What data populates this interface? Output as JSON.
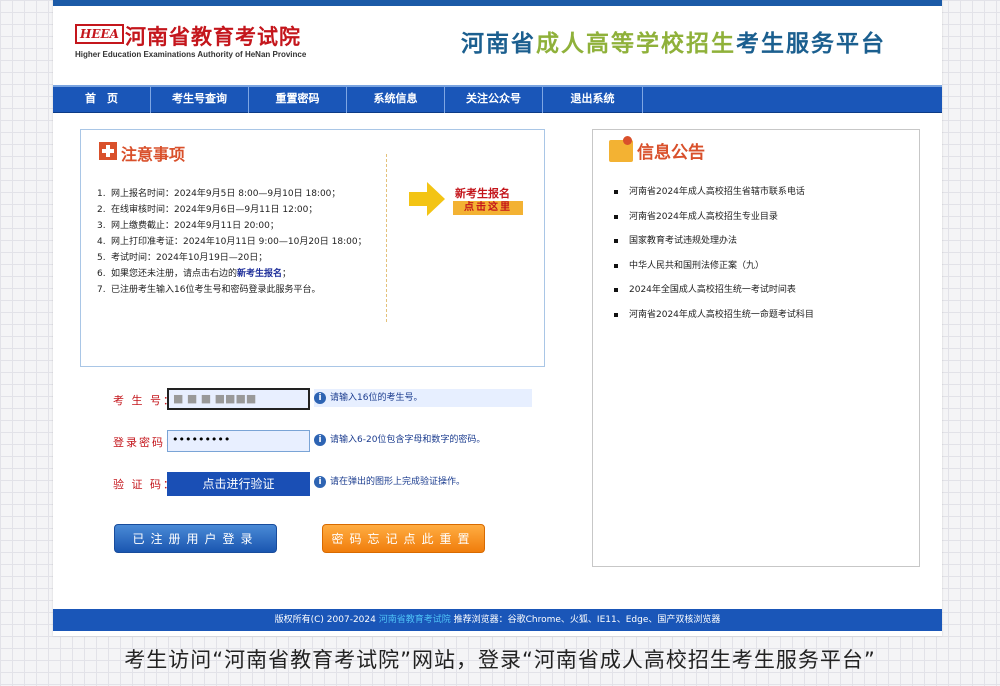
{
  "header": {
    "logo_mark": "HEEA",
    "logo_cn": "河南省教育考试院",
    "logo_en": "Higher Education Examinations Authority of HeNan Province",
    "title_part1": "河南省",
    "title_part2": "成人高等学校招生",
    "title_part3": "考生服务平台"
  },
  "nav": {
    "items": [
      "首　页",
      "考生号查询",
      "重置密码",
      "系统信息",
      "关注公众号",
      "退出系统"
    ]
  },
  "notice": {
    "title": "注意事项",
    "items": [
      {
        "num": "1.",
        "text": "网上报名时间：2024年9月5日 8:00—9月10日 18:00；"
      },
      {
        "num": "2.",
        "text": "在线审核时间：2024年9月6日—9月11日 12:00；"
      },
      {
        "num": "3.",
        "text": "网上缴费截止：2024年9月11日 20:00；"
      },
      {
        "num": "4.",
        "text": "网上打印准考证：2024年10月11日 9:00—10月20日 18:00；"
      },
      {
        "num": "5.",
        "text": "考试时间：2024年10月19日—20日；"
      },
      {
        "num": "6.",
        "text": "如果您还未注册，请点击右边的",
        "highlight": "新考生报名",
        "after": "；"
      },
      {
        "num": "7.",
        "text": "已注册考生输入16位考生号和密码登录此服务平台。"
      }
    ],
    "register_text": "新考生报名",
    "register_click": "点击这里"
  },
  "form": {
    "exam_label": "考 生 号：",
    "exam_value": "■ ■ ■ ■■■■",
    "exam_hint": "请输入16位的考生号。",
    "pwd_label": "登录密码：",
    "pwd_value": "•••••••••",
    "pwd_hint": "请输入6-20位包含字母和数字的密码。",
    "captcha_label": "验 证 码：",
    "captcha_button": "点击进行验证",
    "captcha_hint": "请在弹出的图形上完成验证操作。",
    "login_button": "已注册用户登录",
    "reset_button": "密码忘记点此重置"
  },
  "info": {
    "title": "信息公告",
    "items": [
      "河南省2024年成人高校招生省辖市联系电话",
      "河南省2024年成人高校招生专业目录",
      "国家教育考试违规处理办法",
      "中华人民共和国刑法修正案（九）",
      "2024年全国成人高校招生统一考试时间表",
      "河南省2024年成人高校招生统一命题考试科目"
    ]
  },
  "footer": {
    "prefix": "版权所有(C) 2007-2024 ",
    "link": "河南省教育考试院",
    "suffix": "  推荐浏览器：谷歌Chrome、火狐、IE11、Edge、国产双核浏览器"
  },
  "caption": "考生访问“河南省教育考试院”网站，登录“河南省成人高校招生考生服务平台”",
  "colors": {
    "brand_blue": "#1a56b8",
    "accent_red": "#c4161c",
    "accent_orange": "#f07d0c",
    "accent_green": "#8fb13a"
  }
}
